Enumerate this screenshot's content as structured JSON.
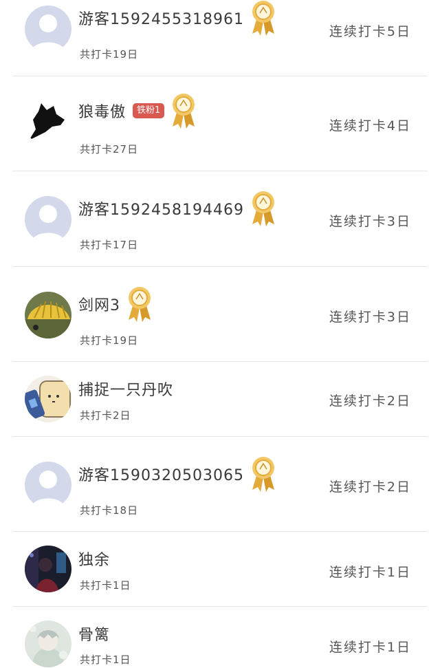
{
  "colors": {
    "divider": "#e6e6e6",
    "fan_badge_bg": "#d9584f",
    "medal_gold": "#e4ab3b",
    "default_avatar_bg": "#d3d9ea"
  },
  "entries": [
    {
      "name": "游客1592455318961",
      "total": "共打卡19日",
      "streak": "连续打卡5日",
      "avatar": "default-avatar",
      "badge": "",
      "medal": "medal-icon"
    },
    {
      "name": "狼毒傲",
      "total": "共打卡27日",
      "streak": "连续打卡4日",
      "avatar": "black-fox-avatar",
      "badge": "铁粉1",
      "medal": "medal-icon"
    },
    {
      "name": "游客1592458194469",
      "total": "共打卡17日",
      "streak": "连续打卡3日",
      "avatar": "default-avatar",
      "badge": "",
      "medal": "medal-icon"
    },
    {
      "name": "剑网3",
      "total": "共打卡19日",
      "streak": "连续打卡3日",
      "avatar": "shell-avatar",
      "badge": "",
      "medal": "medal-icon"
    },
    {
      "name": "捕捉一只丹吹",
      "total": "共打卡2日",
      "streak": "连续打卡2日",
      "avatar": "cartoon-avatar",
      "badge": "",
      "medal": ""
    },
    {
      "name": "游客1590320503065",
      "total": "共打卡18日",
      "streak": "连续打卡2日",
      "avatar": "default-avatar",
      "badge": "",
      "medal": "medal-icon"
    },
    {
      "name": "独余",
      "total": "共打卡1日",
      "streak": "连续打卡1日",
      "avatar": "dark-photo-avatar",
      "badge": "",
      "medal": ""
    },
    {
      "name": "骨篱",
      "total": "共打卡1日",
      "streak": "连续打卡1日",
      "avatar": "anime-avatar",
      "badge": "",
      "medal": ""
    }
  ]
}
